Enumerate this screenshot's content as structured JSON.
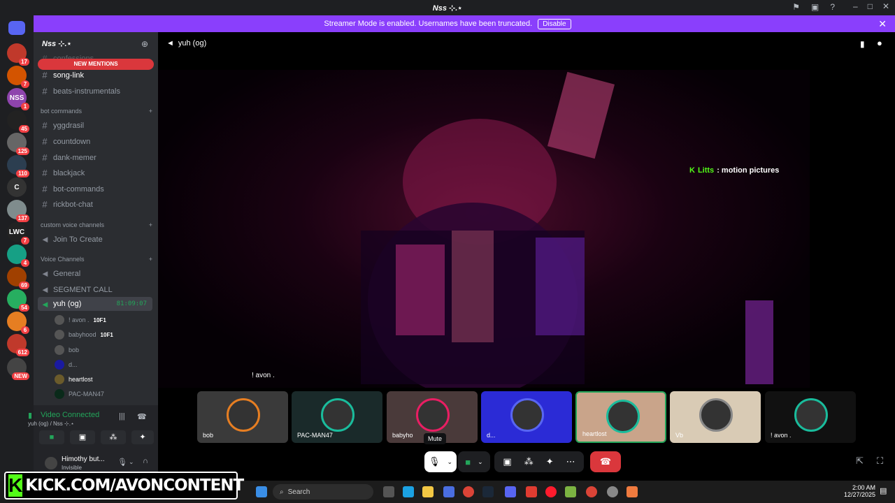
{
  "titlebar": {
    "title": "Nss ⊹.⋆"
  },
  "banner": {
    "text": "Streamer Mode is enabled. Usernames have been truncated.",
    "button": "Disable"
  },
  "servers": [
    {
      "badge": "17"
    },
    {
      "badge": "7"
    },
    {
      "badge": "1",
      "text": "NSS"
    },
    {
      "badge": "45"
    },
    {
      "badge": "125"
    },
    {
      "badge": "110"
    },
    {
      "badge": "",
      "text": "C"
    },
    {
      "badge": "137"
    },
    {
      "badge": "7",
      "text": "LWC"
    },
    {
      "badge": "4"
    },
    {
      "badge": "69"
    },
    {
      "badge": "54"
    },
    {
      "badge": "6"
    },
    {
      "badge": "612"
    },
    {
      "badge": "NEW"
    }
  ],
  "sidebar": {
    "server_name": "Nss ⊹.⋆",
    "new_mentions": "NEW MENTIONS",
    "channels_top": [
      "confessions",
      "song-link",
      "beats-instrumentals"
    ],
    "bot_category": "bot commands",
    "bot_channels": [
      "yggdrasil",
      "countdown",
      "dank-memer",
      "blackjack",
      "bot-commands",
      "rickbot-chat"
    ],
    "custom_category": "custom voice channels",
    "join_create": "Join To Create",
    "voice_category": "Voice Channels",
    "voice_channels": [
      "General",
      "SEGMENT CALL",
      "yuh (og)"
    ],
    "timer": "81:09:07",
    "voice_users": [
      {
        "name": "! avon .",
        "tag": "10F1"
      },
      {
        "name": "babyhood",
        "tag": "10F1"
      },
      {
        "name": "bob",
        "tag": ""
      },
      {
        "name": "d...",
        "tag": ""
      },
      {
        "name": "heartlost",
        "tag": ""
      },
      {
        "name": "PAC-MAN47",
        "tag": ""
      }
    ]
  },
  "vc_panel": {
    "status": "Video Connected",
    "channel": "yuh (og) / Nss ⊹.⋆"
  },
  "user_panel": {
    "name": "Himothy but...",
    "status": "Invisible"
  },
  "main": {
    "channel": "yuh (og)",
    "overlay_user": "Litts",
    "overlay_text": ": motion pictures",
    "speaker_label": "! avon ."
  },
  "thumbnails": [
    {
      "label": "bob",
      "color": "#e67e22"
    },
    {
      "label": "PAC-MAN47",
      "color": "#1abc9c"
    },
    {
      "label": "babyho",
      "color": "#e91e63"
    },
    {
      "label": "d...",
      "color": "#5865f2"
    },
    {
      "label": "heartlost",
      "color": "#1abc9c"
    },
    {
      "label": "Vb",
      "color": "#888888"
    },
    {
      "label": "! avon .",
      "color": "#1abc9c"
    }
  ],
  "tooltip": "Mute",
  "taskbar": {
    "search": "Search",
    "time": "2:00 AM",
    "date": "12/27/2025"
  },
  "watermark": "KICK.COM/AVONCONTENT"
}
